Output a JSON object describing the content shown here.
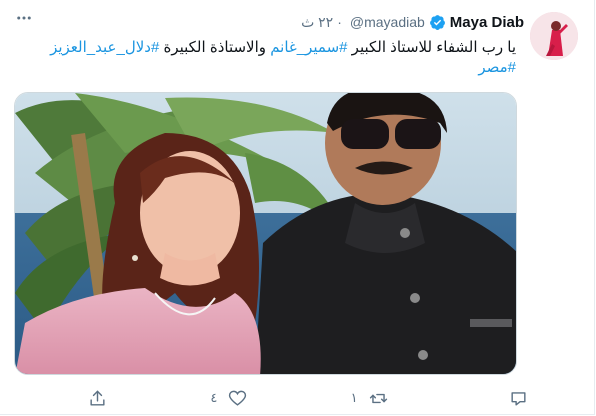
{
  "tweet": {
    "author_name": "Maya Diab",
    "handle": "@mayadiab",
    "separator": "·",
    "time": "٢٢ ث",
    "text_plain": "يا رب الشفاء للاستاذ الكبير ",
    "hashtag_1": "#سمير_غانم",
    "text_mid": " والاستاذة الكبيرة ",
    "hashtag_2": "#دلال_عبد_العزيز",
    "hashtag_3": "#مصر"
  },
  "actions": {
    "reply_count": "",
    "retweet_count": "١",
    "like_count": "٤"
  },
  "icons": {
    "more": "more-icon",
    "verified": "verified-badge-icon",
    "reply": "reply-icon",
    "retweet": "retweet-icon",
    "like": "like-icon",
    "share": "share-icon"
  },
  "colors": {
    "link": "#1b95e0",
    "muted": "#5b7083",
    "verified": "#1da1f2"
  }
}
